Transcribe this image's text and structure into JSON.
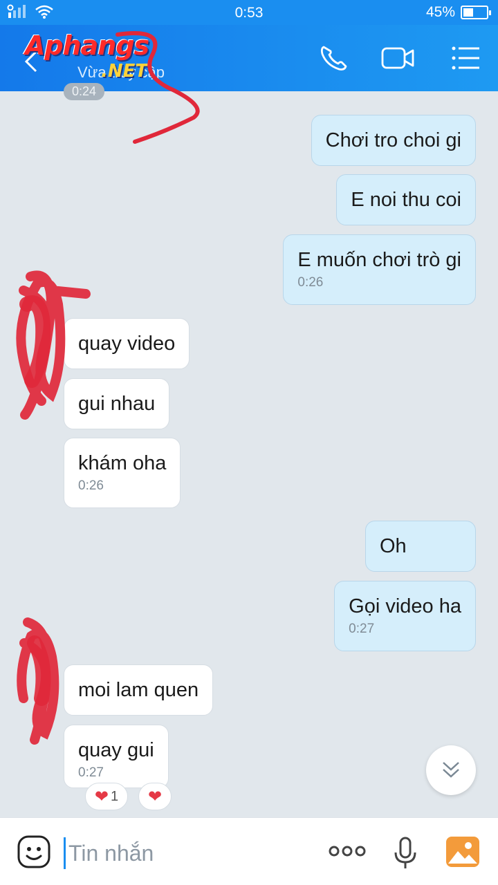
{
  "status_bar": {
    "time": "0:53",
    "battery_text": "45%",
    "battery_level": 0.45
  },
  "header": {
    "watermark_main": "Aphangs",
    "watermark_sub": ".NET",
    "subtitle": "Vừa truy cập",
    "icons": [
      "back-arrow-icon",
      "phone-icon",
      "video-call-icon",
      "menu-icon"
    ]
  },
  "chat": {
    "top_time": "0:24",
    "messages": [
      {
        "side": "out",
        "text": "Chơi tro choi gi",
        "time": ""
      },
      {
        "side": "out",
        "text": "E noi thu coi",
        "time": ""
      },
      {
        "side": "out",
        "text": "E muốn chơi trò gi",
        "time": "0:26"
      },
      {
        "side": "in",
        "text": "quay video",
        "time": ""
      },
      {
        "side": "in",
        "text": "gui nhau",
        "time": ""
      },
      {
        "side": "in",
        "text": "khám oha",
        "time": "0:26"
      },
      {
        "side": "out",
        "text": "Oh",
        "time": ""
      },
      {
        "side": "out",
        "text": "Gọi video ha",
        "time": "0:27"
      },
      {
        "side": "in",
        "text": "moi lam quen",
        "time": ""
      },
      {
        "side": "in",
        "text": "quay gui",
        "time": "0:27"
      }
    ],
    "reactions": [
      {
        "emoji": "❤",
        "count": "1"
      },
      {
        "emoji": "❤",
        "count": ""
      }
    ]
  },
  "input_bar": {
    "placeholder": "Tin nhắn",
    "icons": [
      "emoji-icon",
      "more-icon",
      "microphone-icon",
      "photo-icon"
    ]
  },
  "colors": {
    "header_blue": "#1a8ef0",
    "outgoing_bubble": "#d5eefb",
    "incoming_bubble": "#ffffff",
    "chat_background": "#e1e7ec",
    "scribble_red": "#e0283a"
  }
}
